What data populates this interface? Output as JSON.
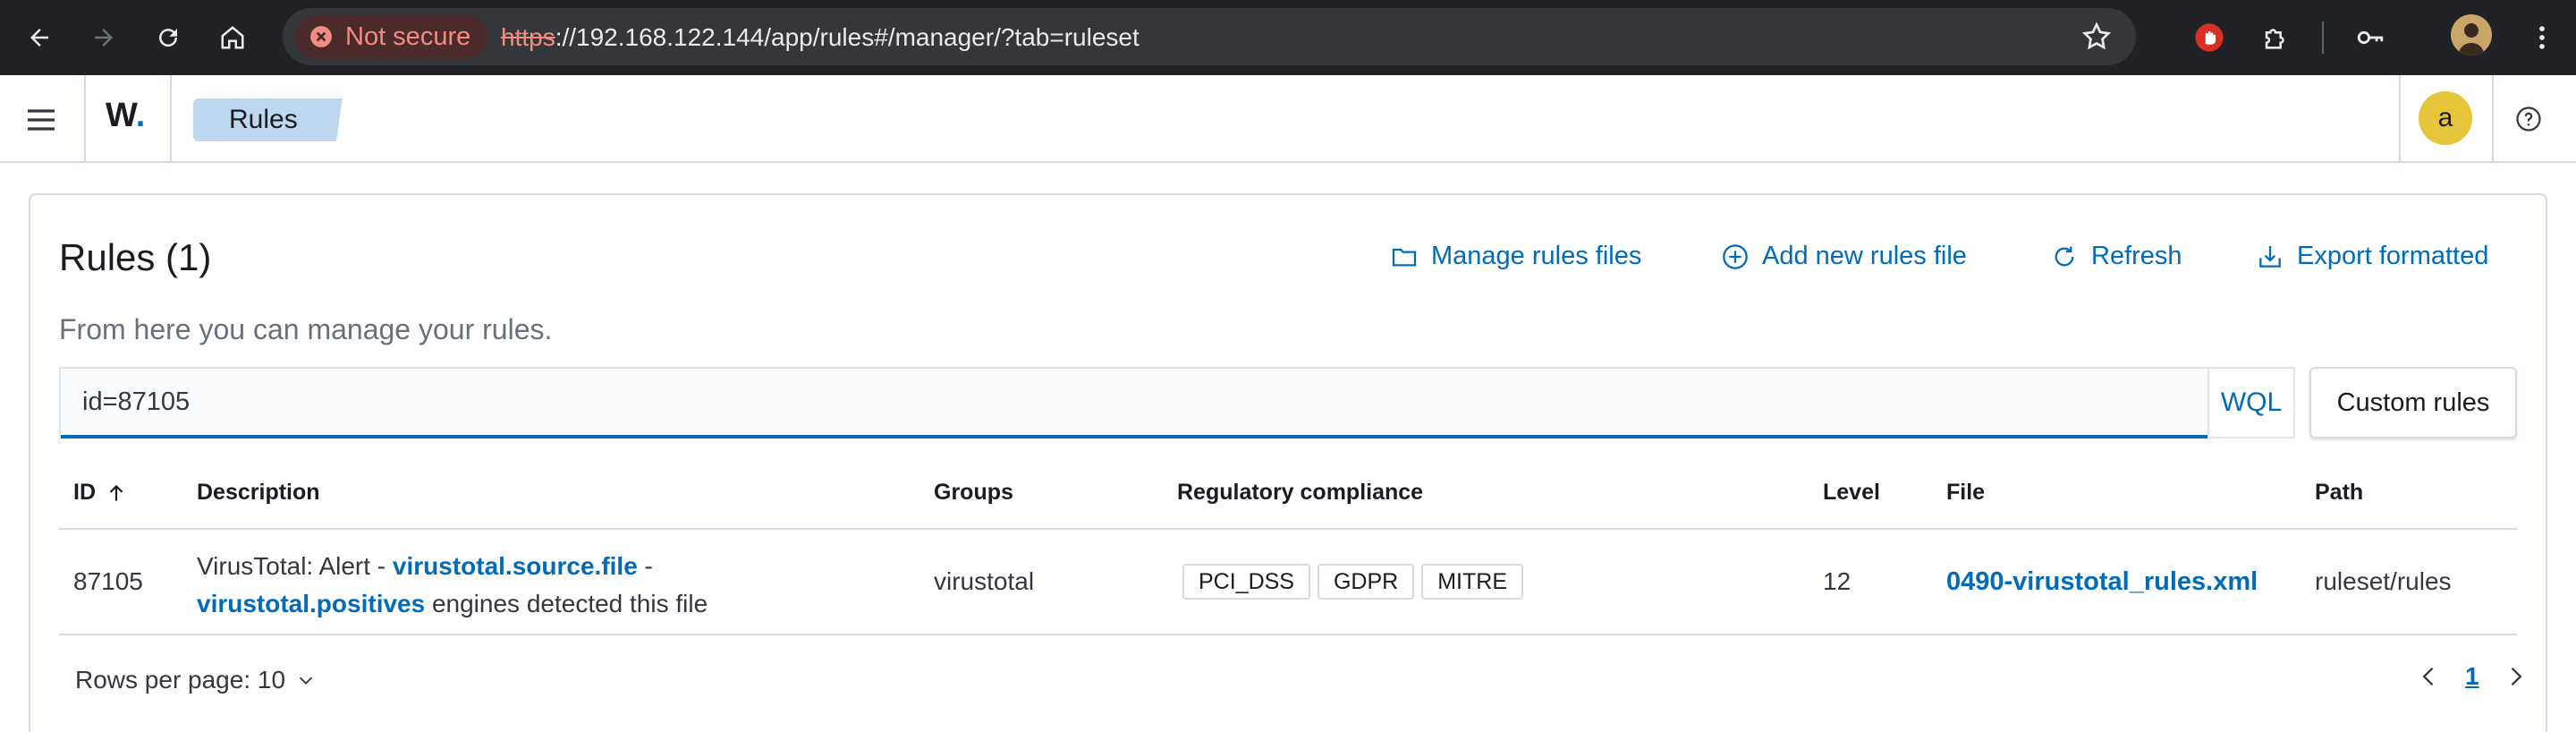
{
  "browser": {
    "security_label": "Not secure",
    "url_scheme": "https",
    "url_rest": "://192.168.122.144/app/rules#/manager/?tab=ruleset"
  },
  "app": {
    "logo_text": "W",
    "logo_dot": ".",
    "breadcrumb": "Rules",
    "avatar_letter": "a"
  },
  "panel": {
    "title": "Rules (1)",
    "subtitle": "From here you can manage your rules.",
    "actions": {
      "manage": "Manage rules files",
      "add": "Add new rules file",
      "refresh": "Refresh",
      "export": "Export formatted"
    },
    "search": {
      "value": "id=87105",
      "wql_label": "WQL"
    },
    "custom_rules_label": "Custom rules"
  },
  "table": {
    "headers": {
      "id": "ID",
      "description": "Description",
      "groups": "Groups",
      "compliance": "Regulatory compliance",
      "level": "Level",
      "file": "File",
      "path": "Path"
    },
    "rows": [
      {
        "id": "87105",
        "desc_prefix": "VirusTotal: Alert - ",
        "desc_link1": "virustotal.source.file",
        "desc_mid": " -",
        "desc_link2": "virustotal.positives",
        "desc_suffix": " engines detected this file",
        "groups": "virustotal",
        "compliance": [
          "PCI_DSS",
          "GDPR",
          "MITRE"
        ],
        "level": "12",
        "file": "0490-virustotal_rules.xml",
        "path": "ruleset/rules"
      }
    ]
  },
  "pagination": {
    "rows_per_page_label": "Rows per page: 10",
    "current_page": "1"
  },
  "colors": {
    "accent": "#006bb8",
    "chrome_bg": "#202124",
    "avatar_bg": "#e7c53a",
    "breadcrumb_bg": "#bcd7ee"
  }
}
